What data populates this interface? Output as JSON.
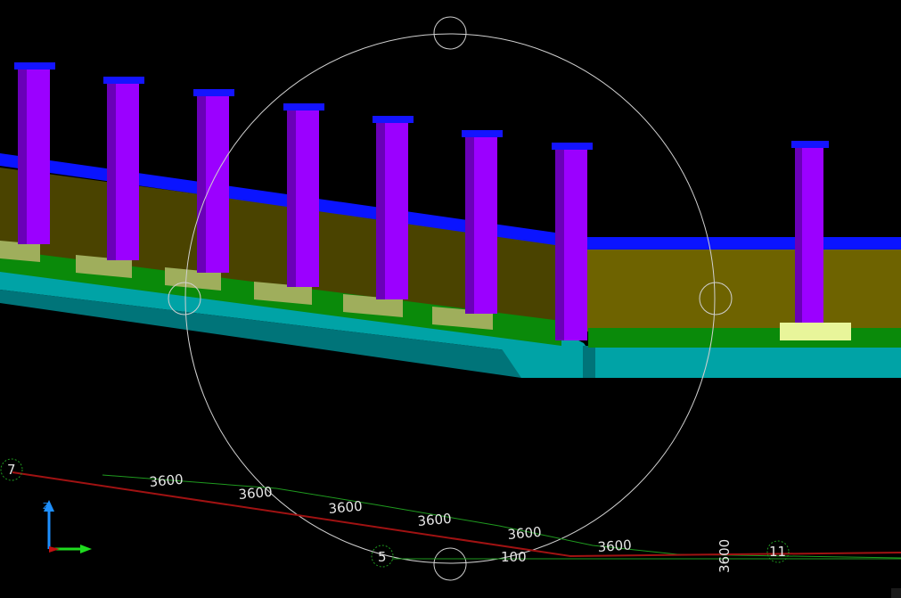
{
  "viewport": {
    "background": "#000000",
    "colors": {
      "column": "#9b00ff",
      "column_shadow": "#6a00b8",
      "column_cap": "#1414ff",
      "wall": "#6e6300",
      "wall_dark": "#4a4300",
      "beam_top": "#0a14ff",
      "slab": "#00a3a6",
      "slab_dark": "#007479",
      "curb": "#0a8a0a",
      "curb_dark": "#055a05",
      "pad": "#e8f59a",
      "pad_dim": "#9fae5c",
      "orbit_circle": "#d0d0d0",
      "grid_line": "#1f9a1f",
      "red_line": "#a01212",
      "dim_text": "#e6e6e6"
    },
    "dimensions": [
      "3600",
      "3600",
      "3600",
      "3600",
      "3600",
      "3600",
      "100",
      "3600"
    ],
    "grid_markers": [
      "7",
      "5",
      "11"
    ],
    "axis_label": "Z"
  }
}
